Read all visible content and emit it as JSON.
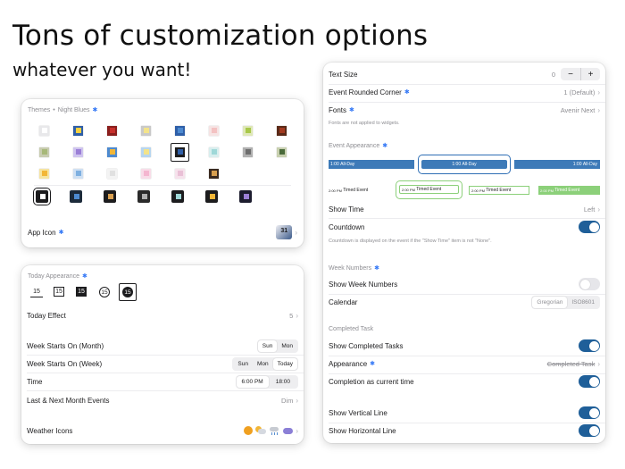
{
  "headline": "Tons of customization options",
  "subhead": "whatever you want!",
  "themes": {
    "header": "Themes",
    "dot": "•",
    "current": "Night Blues",
    "app_icon_label": "App Icon"
  },
  "today_card": {
    "section_title": "Today Appearance",
    "today_options": [
      "15",
      "15",
      "15",
      "15",
      "15"
    ],
    "today_effect_label": "Today Effect",
    "today_effect_value": "5",
    "week_month_label": "Week Starts On (Month)",
    "week_month_options": [
      "Sun",
      "Mon"
    ],
    "week_week_label": "Week Starts On (Week)",
    "week_week_options": [
      "Sun",
      "Mon",
      "Today"
    ],
    "time_label": "Time",
    "time_options": [
      "6:00 PM",
      "18:00"
    ],
    "last_next_label": "Last & Next Month Events",
    "last_next_value": "Dim",
    "weather_label": "Weather Icons"
  },
  "settings": {
    "text_size_label": "Text Size",
    "text_size_value": "0",
    "minus": "−",
    "plus": "+",
    "rounded_label": "Event Rounded Corner",
    "rounded_value": "1 (Default)",
    "fonts_label": "Fonts",
    "fonts_value": "Avenir Next",
    "fonts_note": "Fonts are not applied to widgets.",
    "event_appearance_header": "Event Appearance",
    "allday_text": "All-Day",
    "allday_time": "1:00",
    "timed_text": "Timed Event",
    "timed_time": "2:00 PM",
    "show_time_label": "Show Time",
    "show_time_value": "Left",
    "countdown_label": "Countdown",
    "countdown_note": "Countdown is displayed on the event if the \"Show Time\" item is not \"None\".",
    "week_numbers_header": "Week Numbers",
    "show_week_numbers_label": "Show Week Numbers",
    "calendar_label": "Calendar",
    "calendar_options": [
      "Gregorian",
      "ISO8601"
    ],
    "completed_header": "Completed Task",
    "show_completed_label": "Show Completed Tasks",
    "appearance_label": "Appearance",
    "appearance_value": "Completed Task",
    "completion_label": "Completion as current time",
    "show_vertical_label": "Show Vertical Line",
    "show_horizontal_label": "Show Horizontal Line"
  },
  "colors": {
    "accent": "#3478f6",
    "toggle_on": "#1f5f99",
    "event_blue": "#3d7ab8",
    "event_green": "#8cd07a"
  }
}
